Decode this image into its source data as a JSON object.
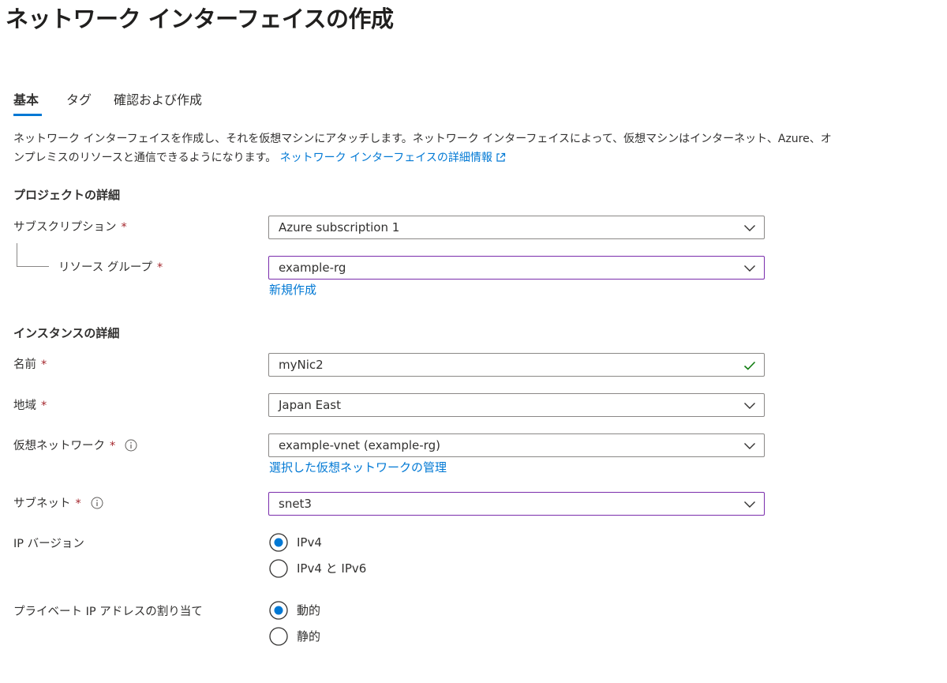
{
  "header": {
    "title": "ネットワーク インターフェイスの作成",
    "more_label": "···"
  },
  "tabs": [
    {
      "label": "基本",
      "active": true
    },
    {
      "label": "タグ",
      "active": false
    },
    {
      "label": "確認および作成",
      "active": false
    }
  ],
  "description": {
    "line1": "ネットワーク インターフェイスを作成し、それを仮想マシンにアタッチします。ネットワーク インターフェイスによって、仮想マシンはインターネット、Azure、オ",
    "line2": "ンプレミスのリソースと通信できるようになります。",
    "link": "ネットワーク インターフェイスの詳細情報"
  },
  "project_details": {
    "title": "プロジェクトの詳細",
    "subscription": {
      "label": "サブスクリプション",
      "required_mark": "*",
      "value": "Azure subscription 1"
    },
    "resource_group": {
      "label": "リソース グループ",
      "required_mark": "*",
      "value": "example-rg",
      "create_new_link": "新規作成"
    }
  },
  "instance_details": {
    "title": "インスタンスの詳細",
    "name": {
      "label": "名前",
      "required_mark": "*",
      "value": "myNic2"
    },
    "region": {
      "label": "地域",
      "required_mark": "*",
      "value": "Japan East"
    },
    "virtual_network": {
      "label": "仮想ネットワーク",
      "required_mark": "*",
      "value": "example-vnet (example-rg)",
      "manage_link": "選択した仮想ネットワークの管理"
    },
    "subnet": {
      "label": "サブネット",
      "required_mark": "*",
      "value": "snet3"
    },
    "ip_version": {
      "label": "IP バージョン",
      "options": [
        {
          "label": "IPv4",
          "selected": true
        },
        {
          "label": "IPv4 と IPv6",
          "selected": false
        }
      ]
    },
    "private_ip": {
      "label": "プライベート IP アドレスの割り当て",
      "options": [
        {
          "label": "動的",
          "selected": true
        },
        {
          "label": "静的",
          "selected": false
        }
      ]
    }
  },
  "colors": {
    "accent": "#0078d4",
    "required": "#a4262c",
    "focus_border": "#7a2dac",
    "valid_check": "#107c10"
  },
  "icons": {
    "dropdown": "chevron-down-icon",
    "valid": "checkmark-icon",
    "info": "info-icon",
    "external": "external-link-icon"
  }
}
